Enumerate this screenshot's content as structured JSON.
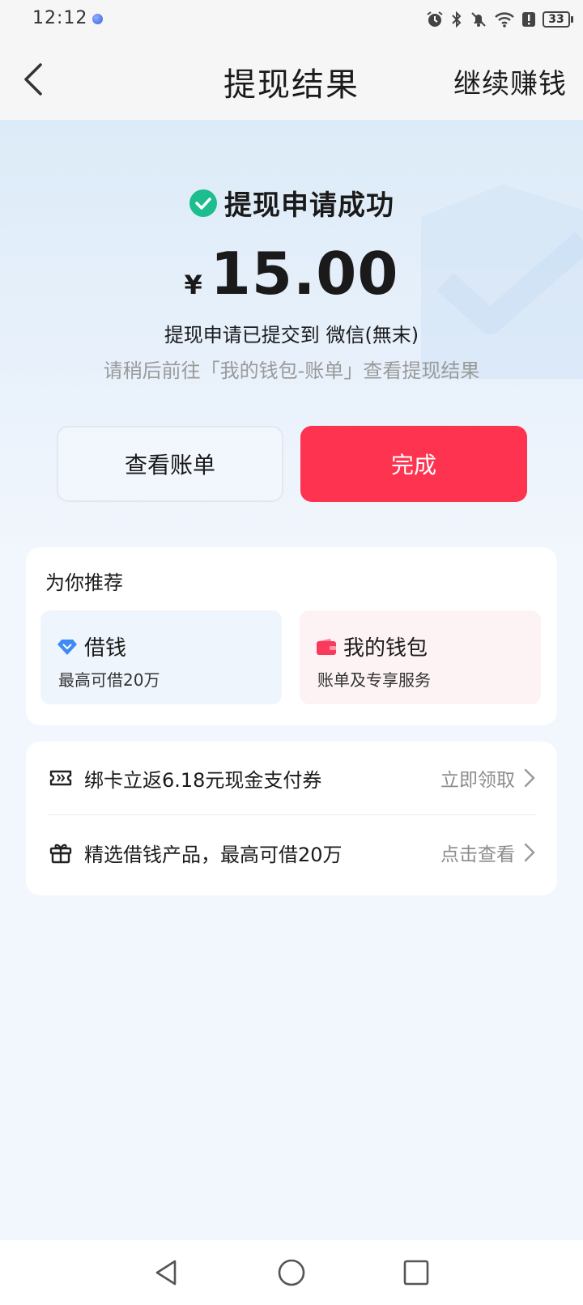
{
  "status_bar": {
    "time": "12:12",
    "battery": "33"
  },
  "nav": {
    "title": "提现结果",
    "action": "继续赚钱"
  },
  "result": {
    "status_text": "提现申请成功",
    "currency": "¥",
    "amount": "15.00",
    "submitted_text": "提现申请已提交到 微信(無末)",
    "hint_text": "请稍后前往「我的钱包-账单」查看提现结果",
    "primary_color": "#fd3350",
    "success_color": "#1ebd8f"
  },
  "buttons": {
    "view_bill": "查看账单",
    "done": "完成"
  },
  "recommend": {
    "title": "为你推荐",
    "items": [
      {
        "name": "借钱",
        "desc": "最高可借20万",
        "icon": "diamond-icon"
      },
      {
        "name": "我的钱包",
        "desc": "账单及专享服务",
        "icon": "wallet-icon"
      }
    ]
  },
  "promos": [
    {
      "text": "绑卡立返6.18元现金支付券",
      "action": "立即领取",
      "icon": "ticket-icon"
    },
    {
      "text": "精选借钱产品，最高可借20万",
      "action": "点击查看",
      "icon": "gift-icon"
    }
  ]
}
